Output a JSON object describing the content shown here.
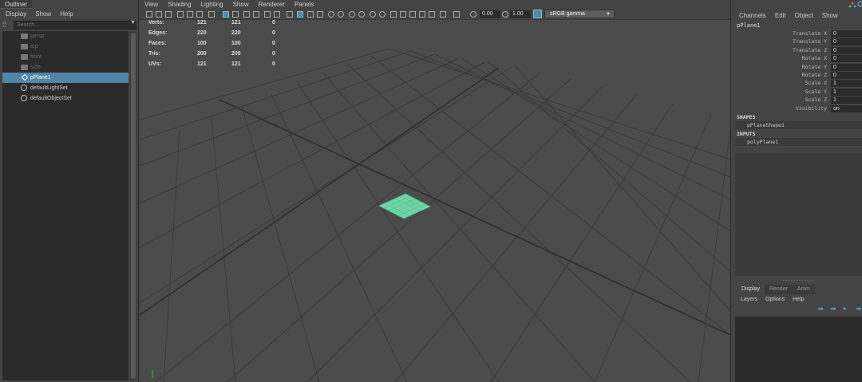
{
  "outliner": {
    "title": "Outliner",
    "menu": [
      "Display",
      "Show",
      "Help"
    ],
    "search_placeholder": "Search...",
    "items": [
      {
        "label": "persp",
        "icon": "camera-icon",
        "dim": true
      },
      {
        "label": "top",
        "icon": "camera-icon",
        "dim": true
      },
      {
        "label": "front",
        "icon": "camera-icon",
        "dim": true
      },
      {
        "label": "side",
        "icon": "camera-icon",
        "dim": true
      },
      {
        "label": "pPlane1",
        "icon": "mesh-icon",
        "selected": true
      },
      {
        "label": "defaultLightSet",
        "icon": "set-icon"
      },
      {
        "label": "defaultObjectSet",
        "icon": "set-icon"
      }
    ]
  },
  "viewport": {
    "menu": [
      "View",
      "Shading",
      "Lighting",
      "Show",
      "Renderer",
      "Panels"
    ],
    "exposure": "0.00",
    "gamma": "1.00",
    "color_space": "sRGB gamma",
    "hud": [
      {
        "label": "Verts:",
        "v1": "121",
        "v2": "121",
        "v3": "0"
      },
      {
        "label": "Edges:",
        "v1": "220",
        "v2": "220",
        "v3": "0"
      },
      {
        "label": "Faces:",
        "v1": "100",
        "v2": "100",
        "v3": "0"
      },
      {
        "label": "Tris:",
        "v1": "200",
        "v2": "200",
        "v3": "0"
      },
      {
        "label": "UVs:",
        "v1": "121",
        "v2": "121",
        "v3": "0"
      }
    ],
    "plane_color": "#6fd6a8",
    "grid_color": "#3a3a3a"
  },
  "channel_box": {
    "menu": [
      "Channels",
      "Edit",
      "Object",
      "Show"
    ],
    "object_name": "pPlane1",
    "attributes": [
      {
        "label": "Translate X",
        "value": "0"
      },
      {
        "label": "Translate Y",
        "value": "0"
      },
      {
        "label": "Translate Z",
        "value": "0"
      },
      {
        "label": "Rotate X",
        "value": "0"
      },
      {
        "label": "Rotate Y",
        "value": "0"
      },
      {
        "label": "Rotate Z",
        "value": "0"
      },
      {
        "label": "Scale X",
        "value": "1"
      },
      {
        "label": "Scale Y",
        "value": "1"
      },
      {
        "label": "Scale Z",
        "value": "1"
      },
      {
        "label": "Visibility",
        "value": "on"
      }
    ],
    "shapes_label": "SHAPES",
    "shape_node": "pPlaneShape1",
    "inputs_label": "INPUTS",
    "input_node": "polyPlane1"
  },
  "layer_editor": {
    "tabs": [
      "Display",
      "Render",
      "Anim"
    ],
    "menu": [
      "Layers",
      "Options",
      "Help"
    ]
  }
}
